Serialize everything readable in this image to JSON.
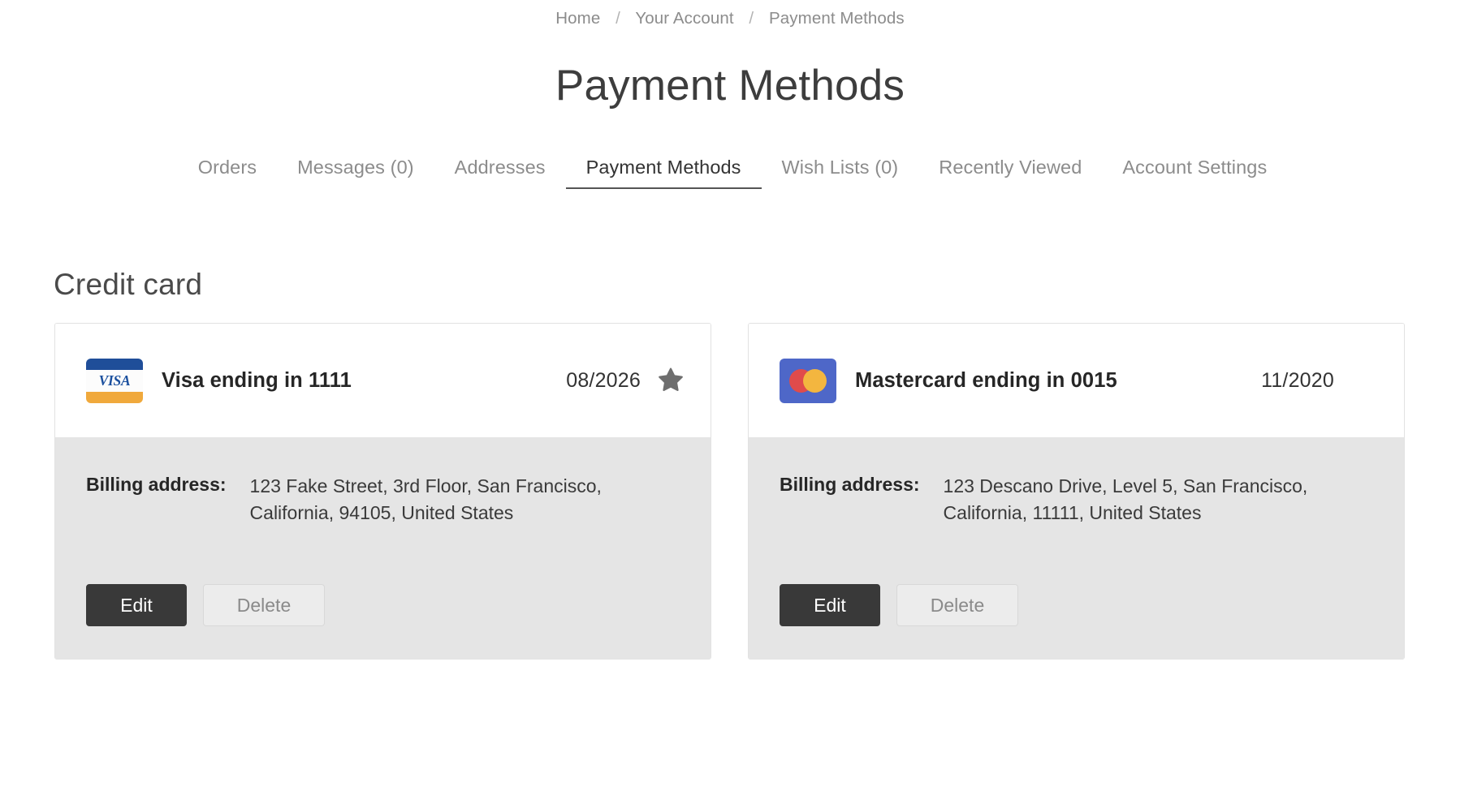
{
  "breadcrumb": {
    "items": [
      {
        "label": "Home"
      },
      {
        "label": "Your Account"
      },
      {
        "label": "Payment Methods"
      }
    ],
    "separator": "/"
  },
  "header": {
    "title": "Payment Methods"
  },
  "tabs": [
    {
      "label": "Orders",
      "active": false
    },
    {
      "label": "Messages (0)",
      "active": false
    },
    {
      "label": "Addresses",
      "active": false
    },
    {
      "label": "Payment Methods",
      "active": true
    },
    {
      "label": "Wish Lists (0)",
      "active": false
    },
    {
      "label": "Recently Viewed",
      "active": false
    },
    {
      "label": "Account Settings",
      "active": false
    }
  ],
  "main": {
    "section_heading": "Credit card",
    "billing_label": "Billing address:",
    "buttons": {
      "edit": "Edit",
      "delete": "Delete"
    },
    "cards": [
      {
        "brand": "visa",
        "brand_text": "VISA",
        "label": "Visa ending in 1111",
        "expiry": "08/2026",
        "is_default": true,
        "billing_address": "123 Fake Street, 3rd Floor, San Francisco, California, 94105, United States"
      },
      {
        "brand": "mastercard",
        "brand_text": "",
        "label": "Mastercard ending in 0015",
        "expiry": "11/2020",
        "is_default": false,
        "billing_address": "123 Descano Drive, Level 5, San Francisco, California, 11111, United States"
      }
    ]
  },
  "colors": {
    "visa_blue": "#1f4e99",
    "visa_orange": "#f0a93c",
    "mastercard_bg": "#4e67c8",
    "mastercard_red": "#e04b4b",
    "mastercard_yellow": "#f3b63f",
    "star_gray": "#6e6e6e",
    "edit_button_bg": "#393939",
    "card_body_bg": "#e5e5e5"
  }
}
